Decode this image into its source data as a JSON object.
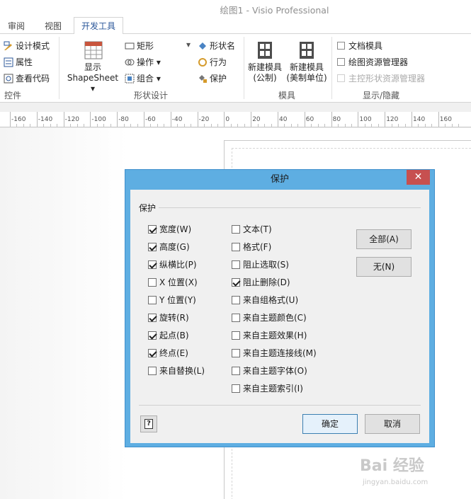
{
  "window": {
    "title": "绘图1 - Visio Professional"
  },
  "tabs": [
    {
      "label": "审阅"
    },
    {
      "label": "视图"
    },
    {
      "label": "开发工具"
    }
  ],
  "ribbon": {
    "controls_group": {
      "label": "控件",
      "items": [
        {
          "label": "设计模式",
          "icon": "design-mode-icon"
        },
        {
          "label": "属性",
          "icon": "properties-icon"
        },
        {
          "label": "查看代码",
          "icon": "view-code-icon"
        }
      ]
    },
    "shape_design_group": {
      "label": "形状设计",
      "show_shapesheet": {
        "line1": "显示",
        "line2": "ShapeSheet ▾"
      },
      "items": [
        {
          "label": "矩形"
        },
        {
          "label": "操作 ▾"
        },
        {
          "label": "组合 ▾"
        },
        {
          "label": "形状名"
        },
        {
          "label": "行为"
        },
        {
          "label": "保护"
        }
      ],
      "dropdown_arrow": "▾"
    },
    "stencil_group": {
      "label": "模具",
      "new_stencil_metric": {
        "line1": "新建模具",
        "line2": "(公制)"
      },
      "new_stencil_us": {
        "line1": "新建模具",
        "line2": "(美制单位)"
      }
    },
    "show_hide_group": {
      "label": "显示/隐藏",
      "items": [
        {
          "label": "文档模具",
          "enabled": true
        },
        {
          "label": "绘图资源管理器",
          "enabled": true
        },
        {
          "label": "主控形状资源管理器",
          "enabled": false
        }
      ]
    }
  },
  "ruler": {
    "ticks": [
      "-160",
      "-140",
      "-120",
      "-100",
      "-80",
      "-60",
      "-40",
      "-20",
      "0",
      "20",
      "40",
      "60",
      "80",
      "100",
      "120",
      "140",
      "160"
    ]
  },
  "dialog": {
    "title": "保护",
    "close": "✕",
    "section_label": "保护",
    "left_column": [
      {
        "label": "宽度(W)",
        "checked": true
      },
      {
        "label": "高度(G)",
        "checked": true
      },
      {
        "label": "纵横比(P)",
        "checked": true
      },
      {
        "label": "X 位置(X)",
        "checked": false
      },
      {
        "label": "Y 位置(Y)",
        "checked": false
      },
      {
        "label": "旋转(R)",
        "checked": true
      },
      {
        "label": "起点(B)",
        "checked": true
      },
      {
        "label": "终点(E)",
        "checked": true
      },
      {
        "label": "来自替换(L)",
        "checked": false
      }
    ],
    "right_column": [
      {
        "label": "文本(T)",
        "checked": false
      },
      {
        "label": "格式(F)",
        "checked": false
      },
      {
        "label": "阻止选取(S)",
        "checked": false
      },
      {
        "label": "阻止删除(D)",
        "checked": true
      },
      {
        "label": "来自组格式(U)",
        "checked": false
      },
      {
        "label": "来自主题颜色(C)",
        "checked": false
      },
      {
        "label": "来自主题效果(H)",
        "checked": false
      },
      {
        "label": "来自主题连接线(M)",
        "checked": false
      },
      {
        "label": "来自主题字体(O)",
        "checked": false
      },
      {
        "label": "来自主题索引(I)",
        "checked": false
      }
    ],
    "all_button": "全部(A)",
    "none_button": "无(N)",
    "ok_button": "确定",
    "cancel_button": "取消",
    "help_glyph": "?"
  },
  "watermark": {
    "line1": "Bai 经验",
    "line2": "jingyan.baidu.com"
  }
}
